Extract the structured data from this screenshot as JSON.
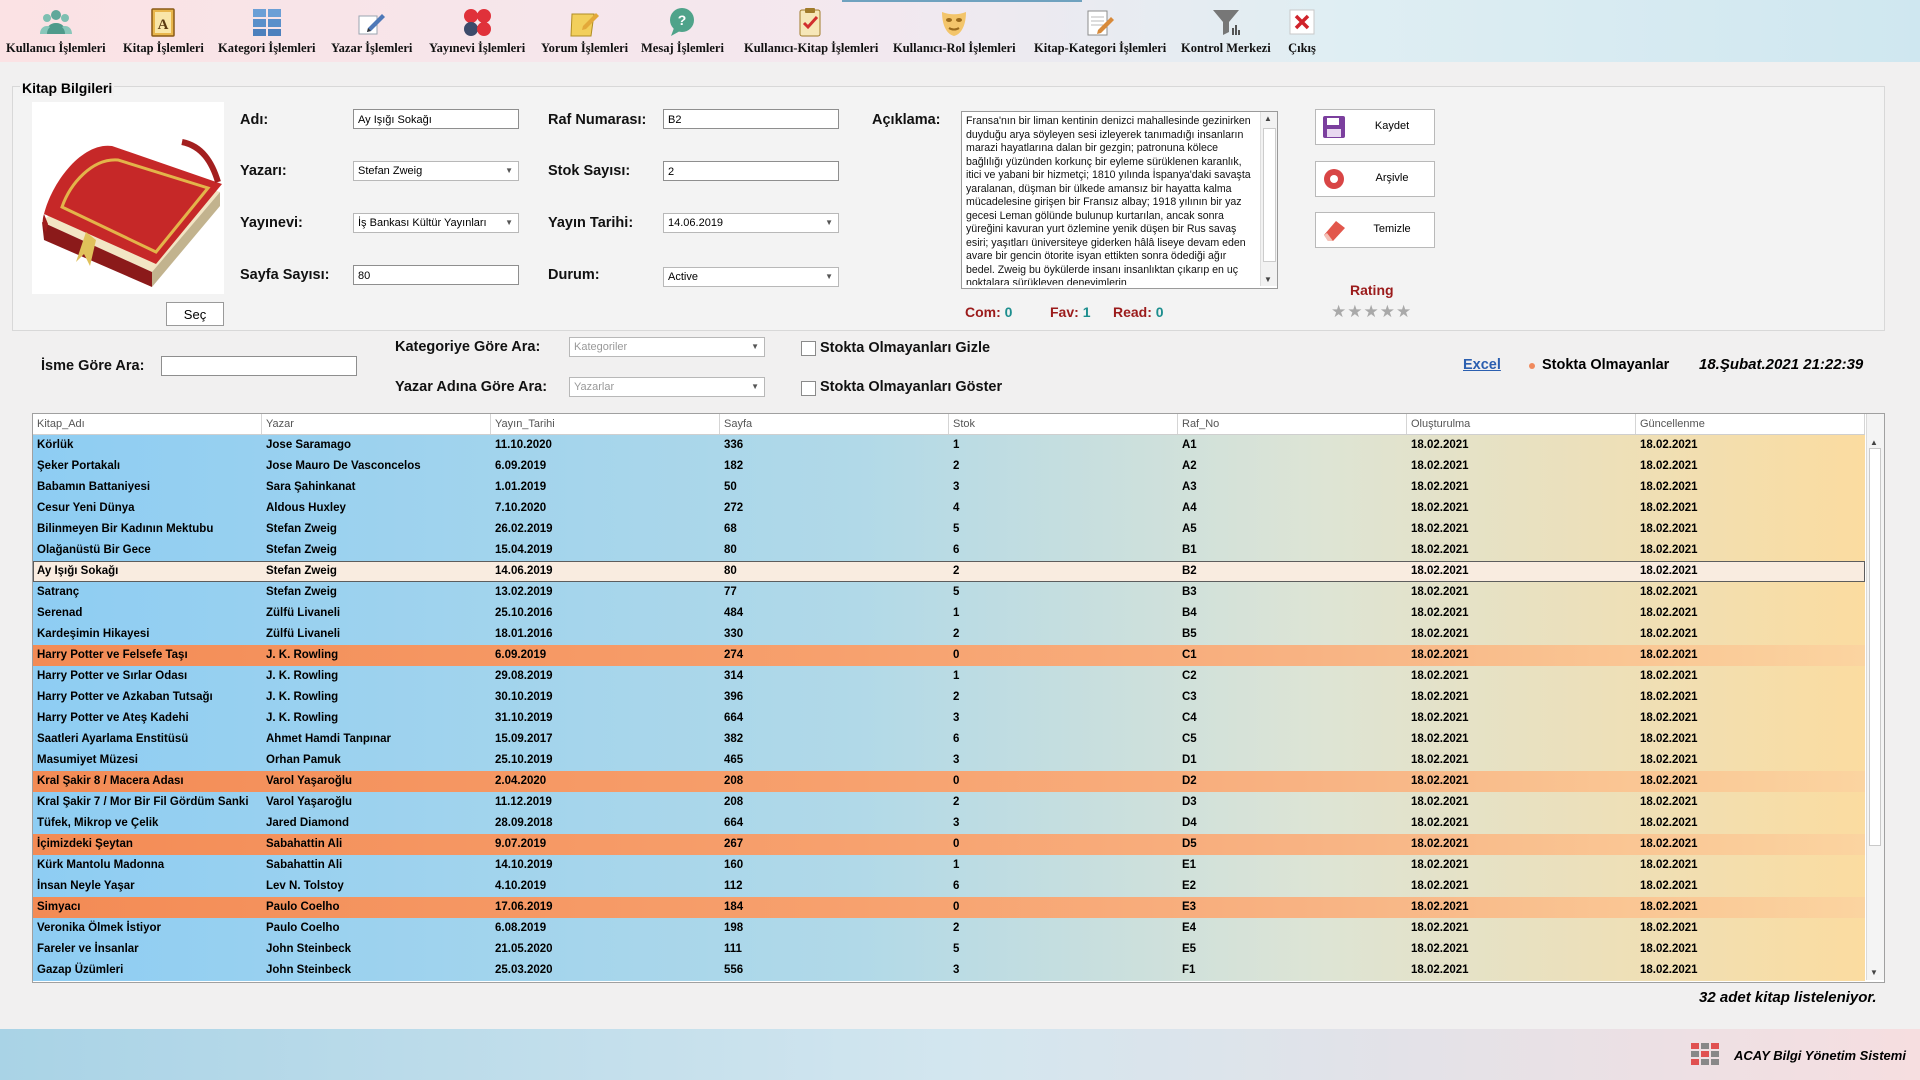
{
  "toolbar": {
    "items": [
      {
        "label": "Kullanıcı İşlemleri",
        "icon": "users-icon"
      },
      {
        "label": "Kitap İşlemleri",
        "icon": "book-icon"
      },
      {
        "label": "Kategori İşlemleri",
        "icon": "grid-icon"
      },
      {
        "label": "Yazar İşlemleri",
        "icon": "pen-icon"
      },
      {
        "label": "Yayınevi İşlemleri",
        "icon": "dots-icon"
      },
      {
        "label": "Yorum İşlemleri",
        "icon": "comment-pencil-icon"
      },
      {
        "label": "Mesaj İşlemleri",
        "icon": "speech-bubble-icon"
      },
      {
        "label": "Kullanıcı-Kitap İşlemleri",
        "icon": "clipboard-check-icon"
      },
      {
        "label": "Kullanıcı-Rol İşlemleri",
        "icon": "mask-icon"
      },
      {
        "label": "Kitap-Kategori İşlemleri",
        "icon": "notepad-pencil-icon"
      },
      {
        "label": "Kontrol Merkezi",
        "icon": "filter-icon"
      },
      {
        "label": "Çıkış",
        "icon": "exit-icon"
      }
    ]
  },
  "book_info": {
    "title": "Kitap Bilgileri",
    "select_button": "Seç",
    "name_label": "Adı:",
    "name_value": "Ay Işığı Sokağı",
    "author_label": "Yazarı:",
    "author_value": "Stefan Zweig",
    "publisher_label": "Yayınevi:",
    "publisher_value": "İş Bankası Kültür Yayınları",
    "pages_label": "Sayfa Sayısı:",
    "pages_value": "80",
    "shelf_label": "Raf Numarası:",
    "shelf_value": "B2",
    "stock_label": "Stok Sayısı:",
    "stock_value": "2",
    "pubdate_label": "Yayın Tarihi:",
    "pubdate_value": "14.06.2019",
    "status_label": "Durum:",
    "status_value": "Active",
    "desc_label": "Açıklama:",
    "desc_value": "Fransa'nın bir liman kentinin denizci mahallesinde gezinirken duyduğu arya söyleyen sesi izleyerek tanımadığı insanların marazi hayatlarına dalan bir gezgin; patronuna kölece bağlılığı yüzünden korkunç bir eyleme sürüklenen karanlık, itici ve yabani bir hizmetçi; 1810 yılında İspanya'daki savaşta yaralanan, düşman bir ülkede amansız bir hayatta kalma mücadelesine girişen bir Fransız albay; 1918 yılının bir yaz gecesi Leman gölünde bulunup kurtarılan, ancak sonra yüreğini kavuran yurt özlemine yenik düşen bir Rus savaş esiri; yaşıtları üniversiteye giderken hâlâ liseye devam eden avare bir gencin ötorite isyan ettikten sonra ödediği ağır bedel. Zweig bu öykülerde insanı insanlıktan çıkarıp en uç noktalara sürükleyen deneyimlerin",
    "com_label": "Com:",
    "com_value": "0",
    "fav_label": "Fav:",
    "fav_value": "1",
    "read_label": "Read:",
    "read_value": "0",
    "save_button": "Kaydet",
    "archive_button": "Arşivle",
    "clear_button": "Temizle",
    "rating_label": "Rating",
    "rating_value": 0,
    "rating_max": 5
  },
  "search": {
    "name_label": "İsme Göre Ara:",
    "name_value": "",
    "category_label": "Kategoriye Göre Ara:",
    "category_placeholder": "Kategoriler",
    "author_label": "Yazar Adına Göre Ara:",
    "author_placeholder": "Yazarlar",
    "hide_out_of_stock": "Stokta Olmayanları Gizle",
    "show_out_of_stock": "Stokta Olmayanları Göster",
    "excel_link": "Excel",
    "legend": "Stokta Olmayanlar",
    "datetime": "18.Şubat.2021 21:22:39"
  },
  "table": {
    "columns": [
      "Kitap_Adı",
      "Yazar",
      "Yayın_Tarihi",
      "Sayfa",
      "Stok",
      "Raf_No",
      "Oluşturulma",
      "Güncellenme"
    ],
    "selected_index": 6,
    "rows": [
      [
        "Körlük",
        "Jose Saramago",
        "11.10.2020",
        "336",
        "1",
        "A1",
        "18.02.2021",
        "18.02.2021"
      ],
      [
        "Şeker Portakalı",
        "Jose Mauro De Vasconcelos",
        "6.09.2019",
        "182",
        "2",
        "A2",
        "18.02.2021",
        "18.02.2021"
      ],
      [
        "Babamın Battaniyesi",
        "Sara Şahinkanat",
        "1.01.2019",
        "50",
        "3",
        "A3",
        "18.02.2021",
        "18.02.2021"
      ],
      [
        "Cesur Yeni Dünya",
        "Aldous Huxley",
        "7.10.2020",
        "272",
        "4",
        "A4",
        "18.02.2021",
        "18.02.2021"
      ],
      [
        "Bilinmeyen Bir Kadının Mektubu",
        "Stefan Zweig",
        "26.02.2019",
        "68",
        "5",
        "A5",
        "18.02.2021",
        "18.02.2021"
      ],
      [
        "Olağanüstü Bir Gece",
        "Stefan Zweig",
        "15.04.2019",
        "80",
        "6",
        "B1",
        "18.02.2021",
        "18.02.2021"
      ],
      [
        "Ay Işığı Sokağı",
        "Stefan Zweig",
        "14.06.2019",
        "80",
        "2",
        "B2",
        "18.02.2021",
        "18.02.2021"
      ],
      [
        "Satranç",
        "Stefan Zweig",
        "13.02.2019",
        "77",
        "5",
        "B3",
        "18.02.2021",
        "18.02.2021"
      ],
      [
        "Serenad",
        "Zülfü Livaneli",
        "25.10.2016",
        "484",
        "1",
        "B4",
        "18.02.2021",
        "18.02.2021"
      ],
      [
        "Kardeşimin Hikayesi",
        "Zülfü Livaneli",
        "18.01.2016",
        "330",
        "2",
        "B5",
        "18.02.2021",
        "18.02.2021"
      ],
      [
        "Harry Potter ve Felsefe Taşı",
        "J. K. Rowling",
        "6.09.2019",
        "274",
        "0",
        "C1",
        "18.02.2021",
        "18.02.2021"
      ],
      [
        "Harry Potter ve Sırlar Odası",
        "J. K. Rowling",
        "29.08.2019",
        "314",
        "1",
        "C2",
        "18.02.2021",
        "18.02.2021"
      ],
      [
        "Harry Potter ve Azkaban Tutsağı",
        "J. K. Rowling",
        "30.10.2019",
        "396",
        "2",
        "C3",
        "18.02.2021",
        "18.02.2021"
      ],
      [
        "Harry Potter ve Ateş Kadehi",
        "J. K. Rowling",
        "31.10.2019",
        "664",
        "3",
        "C4",
        "18.02.2021",
        "18.02.2021"
      ],
      [
        "Saatleri Ayarlama Enstitüsü",
        "Ahmet Hamdi Tanpınar",
        "15.09.2017",
        "382",
        "6",
        "C5",
        "18.02.2021",
        "18.02.2021"
      ],
      [
        "Masumiyet Müzesi",
        "Orhan Pamuk",
        "25.10.2019",
        "465",
        "3",
        "D1",
        "18.02.2021",
        "18.02.2021"
      ],
      [
        "Kral Şakir 8 / Macera Adası",
        "Varol Yaşaroğlu",
        "2.04.2020",
        "208",
        "0",
        "D2",
        "18.02.2021",
        "18.02.2021"
      ],
      [
        "Kral Şakir 7 / Mor Bir Fil Gördüm Sanki",
        "Varol Yaşaroğlu",
        "11.12.2019",
        "208",
        "2",
        "D3",
        "18.02.2021",
        "18.02.2021"
      ],
      [
        "Tüfek, Mikrop ve Çelik",
        "Jared Diamond",
        "28.09.2018",
        "664",
        "3",
        "D4",
        "18.02.2021",
        "18.02.2021"
      ],
      [
        "İçimizdeki Şeytan",
        "Sabahattin Ali",
        "9.07.2019",
        "267",
        "0",
        "D5",
        "18.02.2021",
        "18.02.2021"
      ],
      [
        "Kürk Mantolu Madonna",
        "Sabahattin Ali",
        "14.10.2019",
        "160",
        "1",
        "E1",
        "18.02.2021",
        "18.02.2021"
      ],
      [
        "İnsan Neyle Yaşar",
        "Lev N. Tolstoy",
        "4.10.2019",
        "112",
        "6",
        "E2",
        "18.02.2021",
        "18.02.2021"
      ],
      [
        "Simyacı",
        "Paulo Coelho",
        "17.06.2019",
        "184",
        "0",
        "E3",
        "18.02.2021",
        "18.02.2021"
      ],
      [
        "Veronika Ölmek İstiyor",
        "Paulo Coelho",
        "6.08.2019",
        "198",
        "2",
        "E4",
        "18.02.2021",
        "18.02.2021"
      ],
      [
        "Fareler ve İnsanlar",
        "John Steinbeck",
        "21.05.2020",
        "111",
        "5",
        "E5",
        "18.02.2021",
        "18.02.2021"
      ],
      [
        "Gazap Üzümleri",
        "John Steinbeck",
        "25.03.2020",
        "556",
        "3",
        "F1",
        "18.02.2021",
        "18.02.2021"
      ]
    ]
  },
  "status": {
    "count_text": "32 adet kitap listeleniyor."
  },
  "footer": {
    "brand": "ACAY Bilgi Yönetim Sistemi"
  },
  "colors": {
    "row_in_stock_start": "#8ecdf3",
    "row_in_stock_end": "#fbdca0",
    "row_out_of_stock": "#f38b55",
    "row_selected": "#f9ece0",
    "stat_label": "#9b1b1b",
    "stat_value": "#1c8e8e",
    "link": "#2b5fb0"
  }
}
